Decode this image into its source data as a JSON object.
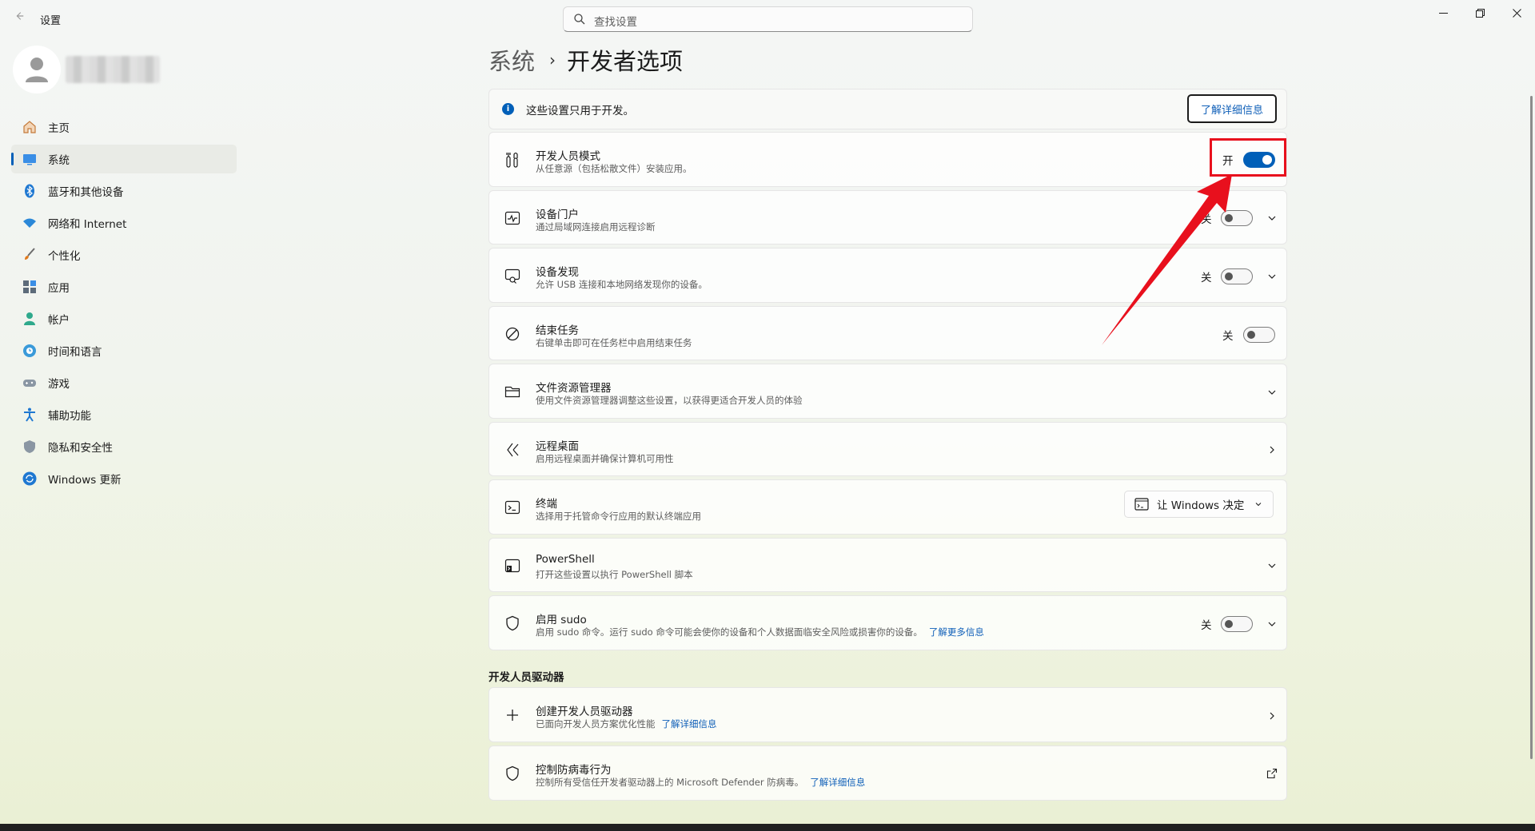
{
  "window": {
    "title": "设置",
    "search_placeholder": "查找设置"
  },
  "sidebar": {
    "items": [
      {
        "label": "主页",
        "icon": "home-icon"
      },
      {
        "label": "系统",
        "icon": "system-display-icon",
        "active": true
      },
      {
        "label": "蓝牙和其他设备",
        "icon": "bluetooth-icon"
      },
      {
        "label": "网络和 Internet",
        "icon": "wifi-icon"
      },
      {
        "label": "个性化",
        "icon": "brush-icon"
      },
      {
        "label": "应用",
        "icon": "apps-icon"
      },
      {
        "label": "帐户",
        "icon": "account-icon"
      },
      {
        "label": "时间和语言",
        "icon": "globe-clock-icon"
      },
      {
        "label": "游戏",
        "icon": "gamepad-icon"
      },
      {
        "label": "辅助功能",
        "icon": "accessibility-icon"
      },
      {
        "label": "隐私和安全性",
        "icon": "shield-icon"
      },
      {
        "label": "Windows 更新",
        "icon": "update-icon"
      }
    ]
  },
  "breadcrumb": {
    "parent": "系统",
    "separator": "›",
    "current": "开发者选项"
  },
  "info_bar": {
    "text": "这些设置只用于开发。",
    "button": "了解详细信息"
  },
  "settings": {
    "dev_mode": {
      "title": "开发人员模式",
      "subtitle": "从任意源（包括松散文件）安装应用。",
      "state_label": "开",
      "on": true
    },
    "device_portal": {
      "title": "设备门户",
      "subtitle": "通过局域网连接启用远程诊断",
      "state_label": "关",
      "on": false
    },
    "device_discovery": {
      "title": "设备发现",
      "subtitle": "允许 USB 连接和本地网络发现你的设备。",
      "state_label": "关",
      "on": false
    },
    "end_task": {
      "title": "结束任务",
      "subtitle": "右键单击即可在任务栏中启用结束任务",
      "state_label": "关",
      "on": false
    },
    "file_explorer": {
      "title": "文件资源管理器",
      "subtitle": "使用文件资源管理器调整这些设置，以获得更适合开发人员的体验"
    },
    "remote_desktop": {
      "title": "远程桌面",
      "subtitle": "启用远程桌面并确保计算机可用性"
    },
    "terminal": {
      "title": "终端",
      "subtitle": "选择用于托管命令行应用的默认终端应用",
      "dropdown_value": "让 Windows 决定"
    },
    "powershell": {
      "title": "PowerShell",
      "subtitle": "打开这些设置以执行 PowerShell 脚本"
    },
    "sudo": {
      "title": "启用 sudo",
      "subtitle": "启用 sudo 命令。运行 sudo 命令可能会使你的设备和个人数据面临安全风险或损害你的设备。",
      "link": "了解更多信息",
      "state_label": "关",
      "on": false
    }
  },
  "dev_drive_section": {
    "title": "开发人员驱动器",
    "create": {
      "title": "创建开发人员驱动器",
      "subtitle": "已面向开发人员方案优化性能",
      "link": "了解详细信息"
    },
    "antivirus": {
      "title": "控制防病毒行为",
      "subtitle": "控制所有受信任开发者驱动器上的 Microsoft Defender 防病毒。",
      "link": "了解详细信息"
    }
  },
  "colors": {
    "accent": "#005fb8",
    "annotation_red": "#e8101d"
  }
}
